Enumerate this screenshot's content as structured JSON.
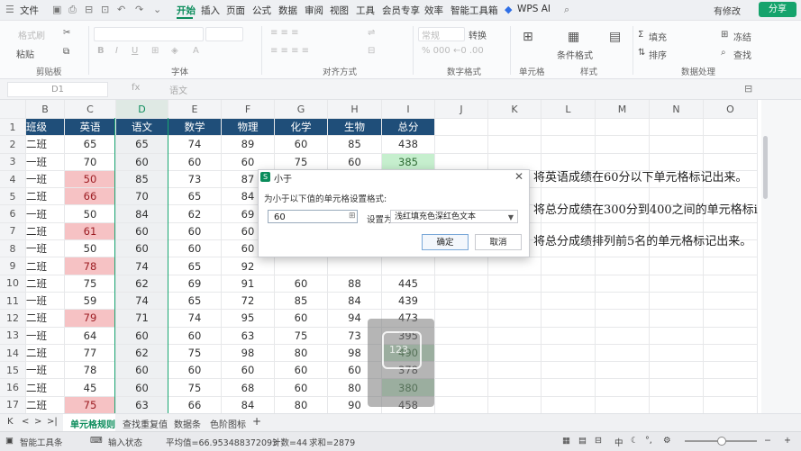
{
  "menubar": {
    "file": "文件",
    "tabs": [
      "开始",
      "插入",
      "页面",
      "公式",
      "数据",
      "审阅",
      "视图",
      "工具",
      "会员专享",
      "效率",
      "智能工具箱"
    ],
    "wps_ai": "WPS AI",
    "edit_mode": "有修改",
    "share": "分享"
  },
  "ribbon": {
    "format_painter": "格式刷",
    "paste": "粘贴",
    "convert": "转换",
    "fill": "填充",
    "freeze": "冻结",
    "sort": "排序",
    "find": "查找",
    "cond_format": "条件格式",
    "general": "常规",
    "insert_row": "行和列",
    "groups": [
      "剪贴板",
      "字体",
      "对齐方式",
      "数字格式",
      "单元格",
      "样式",
      "数据处理"
    ]
  },
  "formula_bar": {
    "name_box": "D1",
    "fx": "fx",
    "content": "语文"
  },
  "sheet": {
    "columns": [
      "B",
      "C",
      "D",
      "E",
      "F",
      "G",
      "H",
      "I",
      "J",
      "K",
      "L",
      "M",
      "N",
      "O"
    ],
    "header": [
      "班级",
      "英语",
      "语文",
      "数学",
      "物理",
      "化学",
      "生物",
      "总分"
    ],
    "rows": [
      [
        "二班",
        "65",
        "65",
        "74",
        "89",
        "60",
        "85",
        "438"
      ],
      [
        "一班",
        "70",
        "60",
        "60",
        "60",
        "75",
        "60",
        "385"
      ],
      [
        "一班",
        "50",
        "85",
        "73",
        "87",
        "",
        "",
        ""
      ],
      [
        "二班",
        "66",
        "70",
        "65",
        "84",
        "",
        "",
        ""
      ],
      [
        "一班",
        "50",
        "84",
        "62",
        "69",
        "",
        "",
        ""
      ],
      [
        "二班",
        "61",
        "60",
        "60",
        "60",
        "",
        "",
        ""
      ],
      [
        "一班",
        "50",
        "60",
        "60",
        "60",
        "",
        "",
        ""
      ],
      [
        "二班",
        "78",
        "74",
        "65",
        "92",
        "",
        "",
        ""
      ],
      [
        "二班",
        "75",
        "62",
        "69",
        "91",
        "60",
        "88",
        "445"
      ],
      [
        "一班",
        "59",
        "74",
        "65",
        "72",
        "85",
        "84",
        "439"
      ],
      [
        "二班",
        "79",
        "71",
        "74",
        "95",
        "60",
        "94",
        "473"
      ],
      [
        "一班",
        "64",
        "60",
        "60",
        "63",
        "75",
        "73",
        "395"
      ],
      [
        "二班",
        "77",
        "62",
        "75",
        "98",
        "80",
        "98",
        "490"
      ],
      [
        "一班",
        "78",
        "60",
        "60",
        "60",
        "60",
        "60",
        "378"
      ],
      [
        "二班",
        "45",
        "60",
        "75",
        "68",
        "60",
        "80",
        "380"
      ],
      [
        "二班",
        "75",
        "63",
        "66",
        "84",
        "80",
        "90",
        "458"
      ],
      [
        "一班",
        "77",
        "63",
        "65",
        "89",
        "60",
        "84",
        "438"
      ],
      [
        "二班",
        "62",
        "74",
        "75",
        "96",
        "60",
        "84",
        "451"
      ]
    ],
    "pink_cells": [
      [
        3,
        1
      ],
      [
        4,
        1
      ],
      [
        6,
        1
      ],
      [
        8,
        1
      ],
      [
        11,
        1
      ],
      [
        16,
        1
      ]
    ],
    "green_cells": [
      [
        2,
        7
      ],
      [
        13,
        7
      ],
      [
        15,
        7
      ]
    ]
  },
  "notes": {
    "note1": "将英语成绩在60分以下单元格标记出来。",
    "note2": "将总分成绩在300分到400之间的单元格标i",
    "note3": "将总分成绩排列前5名的单元格标记出来。"
  },
  "dialog": {
    "title": "小于",
    "description": "为小于以下值的单元格设置格式:",
    "value": "60",
    "set_as": "设置为",
    "format": "浅红填充色深红色文本",
    "ok": "确定",
    "cancel": "取消"
  },
  "overlay": {
    "text": "123"
  },
  "tabs": {
    "items": [
      "单元格规则",
      "查找重复值",
      "数据条",
      "色阶图标"
    ],
    "add": "+"
  },
  "status": {
    "workbook": "智能工具条",
    "input_state": "输入状态",
    "average": "平均值=66.953488372093",
    "count": "计数=44",
    "sum": "求和=2879"
  }
}
